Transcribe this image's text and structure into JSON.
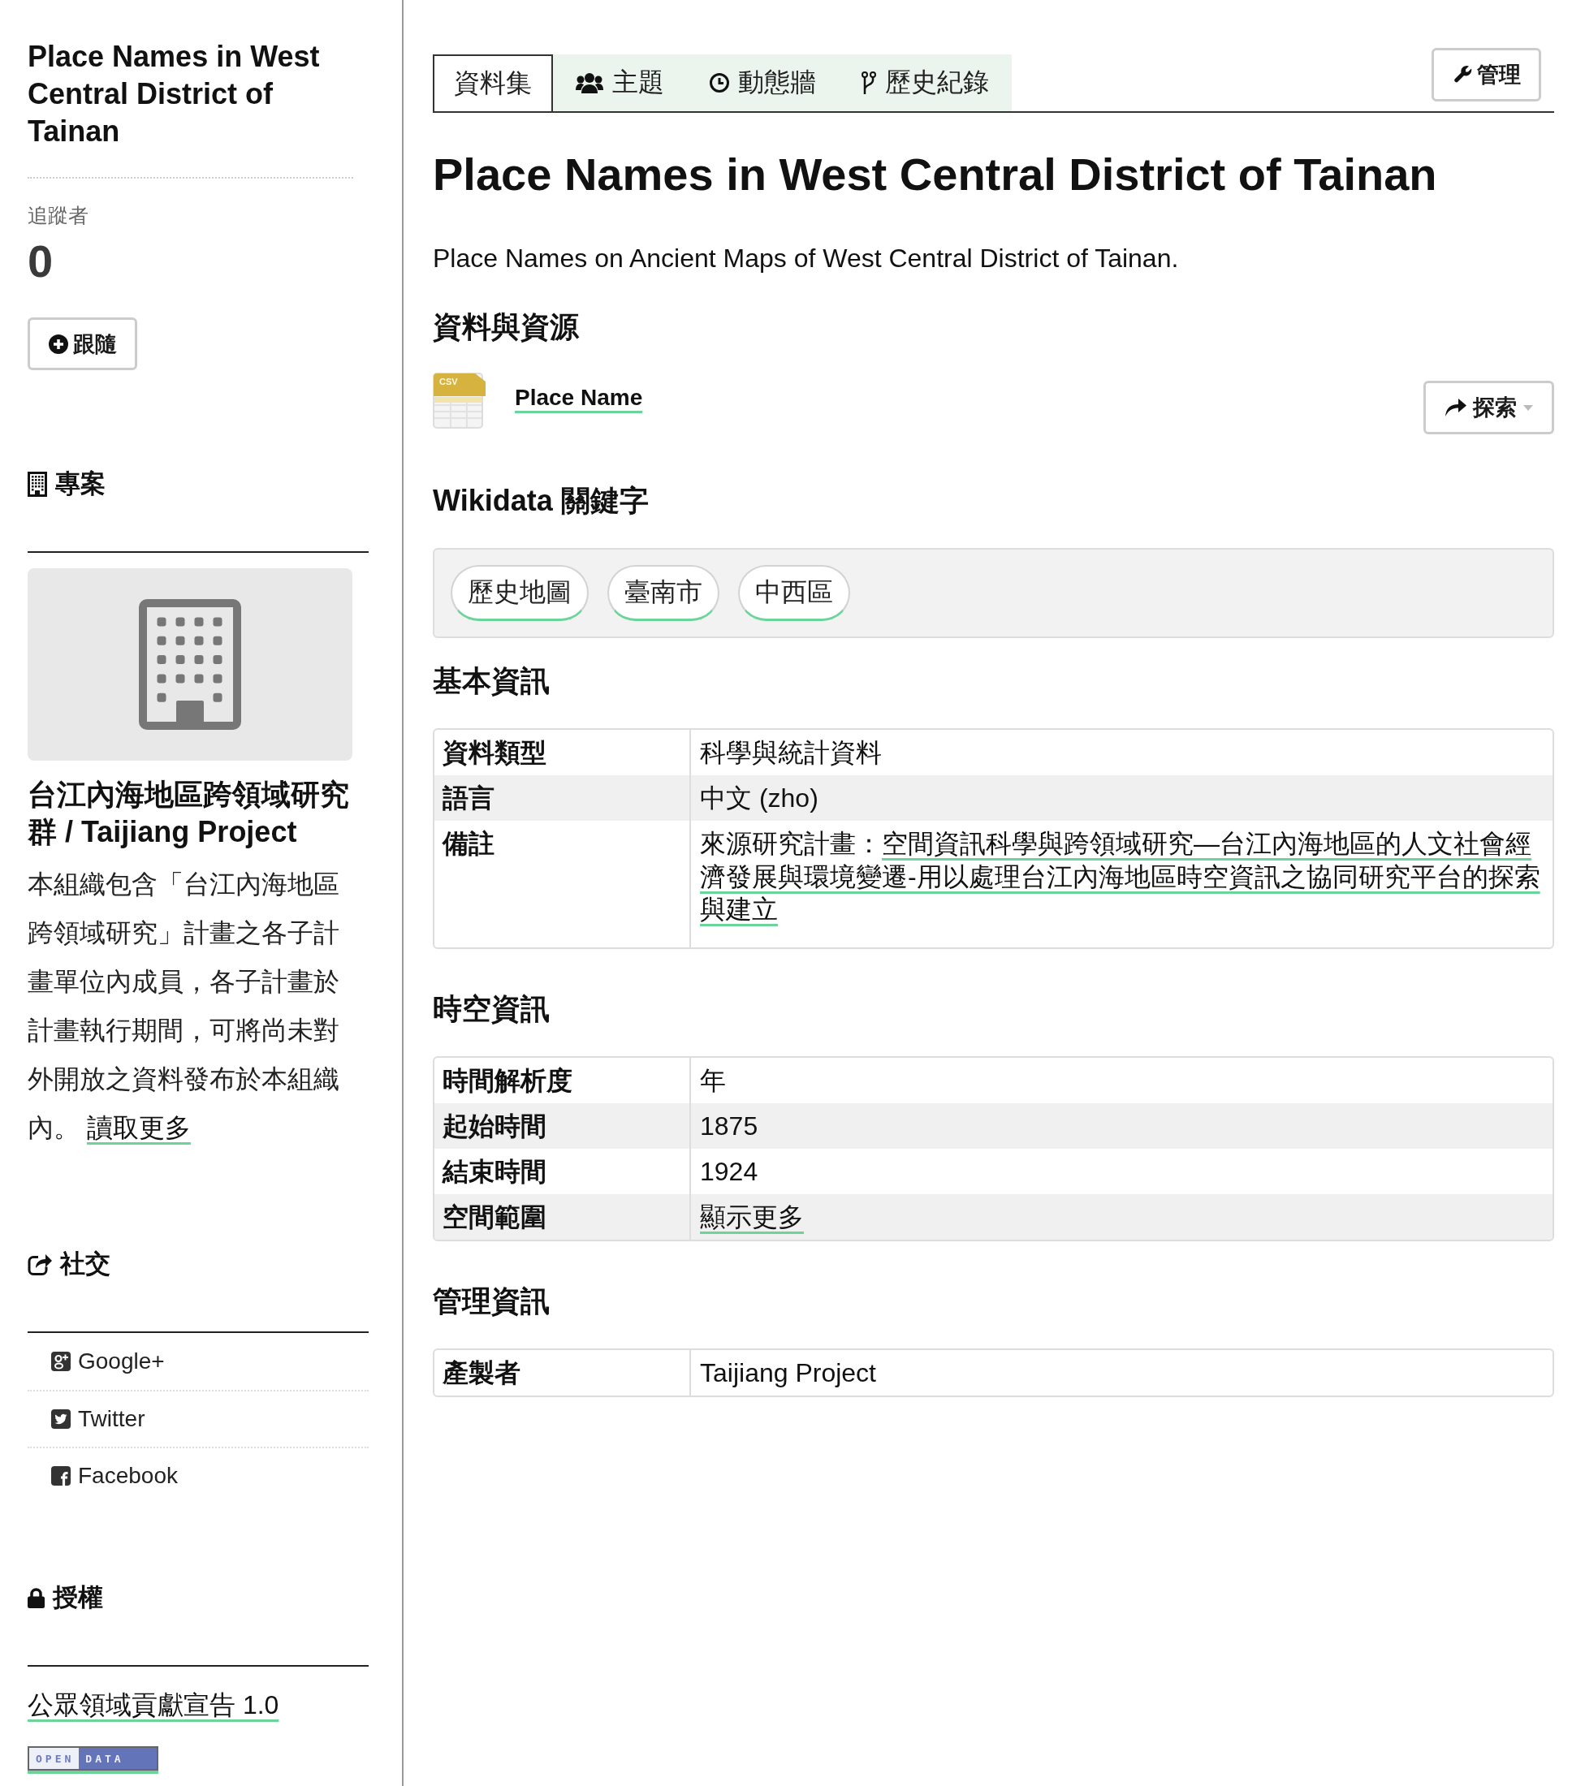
{
  "sidebar": {
    "title": "Place Names in West Central District of Tainan",
    "followers": {
      "label": "追蹤者",
      "count": "0"
    },
    "follow_button": "跟隨",
    "organization": {
      "heading": "專案",
      "name": "台江內海地區跨領域研究群 / Taijiang Project",
      "description": "本組織包含「台江內海地區跨領域研究」計畫之各子計畫單位內成員，各子計畫於計畫執行期間，可將尚未對外開放之資料發布於本組織內。",
      "read_more": "讀取更多"
    },
    "social": {
      "heading": "社交",
      "items": [
        {
          "label": "Google+"
        },
        {
          "label": "Twitter"
        },
        {
          "label": "Facebook"
        }
      ]
    },
    "license": {
      "heading": "授權",
      "link": "公眾領域貢獻宣告 1.0",
      "badge": {
        "left": "OPEN",
        "right": "DATA"
      }
    }
  },
  "tabs": [
    {
      "label": "資料集",
      "selected": true
    },
    {
      "label": "主題",
      "selected": false
    },
    {
      "label": "動態牆",
      "selected": false
    },
    {
      "label": "歷史紀錄",
      "selected": false
    }
  ],
  "manage_button": "管理",
  "dataset": {
    "title": "Place Names in West Central District of Tainan",
    "description": "Place Names on Ancient Maps of West Central District of Tainan."
  },
  "resources": {
    "heading": "資料與資源",
    "items": [
      {
        "format": "CSV",
        "name": "Place Name",
        "explore_button": "探索"
      }
    ]
  },
  "keywords": {
    "heading": "Wikidata 關鍵字",
    "tags": [
      "歷史地圖",
      "臺南市",
      "中西區"
    ]
  },
  "basic_info": {
    "heading": "基本資訊",
    "rows": [
      {
        "kind": "text",
        "label": "資料類型",
        "value": "科學與統計資料"
      },
      {
        "kind": "text",
        "label": "語言",
        "value": "中文 (zho)"
      },
      {
        "kind": "note",
        "label": "備註",
        "value": "來源研究計畫：",
        "link": "空間資訊科學與跨領域研究—台江內海地區的人文社會經濟發展與環境變遷-用以處理台江內海地區時空資訊之協同研究平台的探索與建立"
      }
    ]
  },
  "spatiotemporal_info": {
    "heading": "時空資訊",
    "rows": [
      {
        "kind": "text",
        "label": "時間解析度",
        "value": "年"
      },
      {
        "kind": "text",
        "label": "起始時間",
        "value": "1875"
      },
      {
        "kind": "text",
        "label": "結束時間",
        "value": "1924"
      },
      {
        "kind": "link",
        "label": "空間範圍",
        "link": "顯示更多"
      }
    ]
  },
  "management_info": {
    "heading": "管理資訊",
    "rows": [
      {
        "kind": "text",
        "label": "產製者",
        "value": "Taijiang Project"
      }
    ]
  }
}
